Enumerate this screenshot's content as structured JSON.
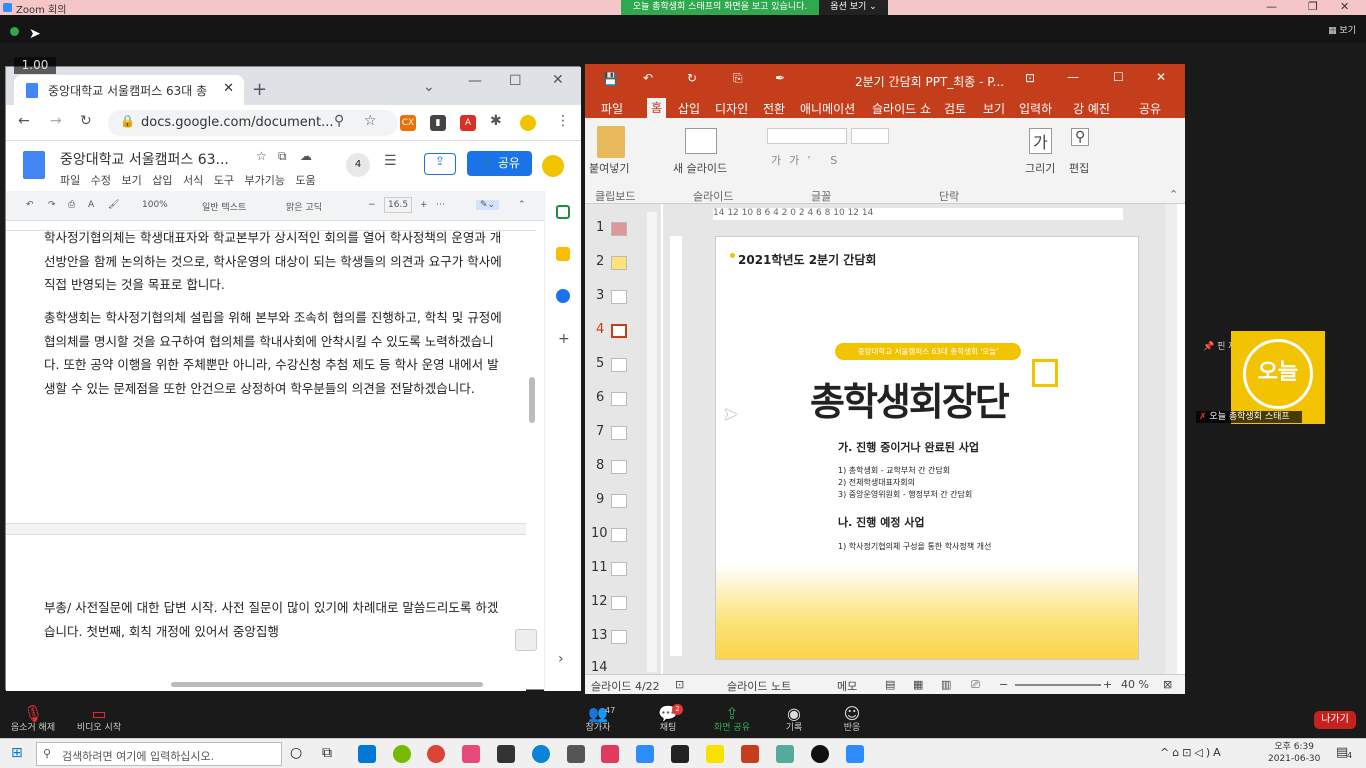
{
  "zoom": {
    "window_title": "Zoom 회의",
    "share_banner": "오늘 총학생회 스태프의 화면을 보고 있습니다.",
    "view_options": "옵션 보기 ⌄",
    "view_label": "▦ 보기",
    "zoom_level": "1.00",
    "pin_label": "📌 핀 제거",
    "participant_name": "오늘 총학생회 스태프",
    "participant_initials": "오늘\nz",
    "bottom": {
      "mute": "음소거 해제",
      "video": "비디오 시작",
      "participants": "참가자",
      "participants_count": "47",
      "chat": "채팅",
      "chat_badge": "2",
      "share": "화면 공유",
      "record": "기록",
      "reactions": "반응",
      "leave": "나가기"
    }
  },
  "chrome": {
    "tab_title": "중앙대학교 서울캠퍼스 63대 총",
    "url": "docs.google.com/document...",
    "doc_title": "중앙대학교 서울캠퍼스 63...",
    "menu": [
      "파일",
      "수정",
      "보기",
      "삽입",
      "서식",
      "도구",
      "부가기능",
      "도움"
    ],
    "share_label": "공유",
    "comment_count": "4",
    "toolbar": {
      "zoom": "100%",
      "style": "일반 텍스트",
      "font": "맑은 고딕",
      "size": "16.5"
    },
    "paragraphs": [
      "학사정기협의체는 학생대표자와 학교본부가 상시적인 회의를 열어 학사정책의 운영과 개선방안을 함께 논의하는 것으로, 학사운영의 대상이 되는 학생들의 의견과 요구가 학사에 직접 반영되는 것을 목표로 합니다.",
      "총학생회는 학사정기협의체 설립을 위해 본부와 조속히 협의를 진행하고, 학칙 및 규정에 협의체를 명시할 것을 요구하여 협의체를 학내사회에 안착시킬 수 있도록 노력하겠습니다. 또한 공약 이행을 위한 주체뿐만 아니라, 수강신청 추첨 제도 등 학사 운영 내에서 발생할 수 있는 문제점을 또한 안건으로 상정하여 학우분들의 의견을 전달하겠습니다.",
      "부총/ 사전질문에 대한 답변 시작. 사전 질문이 많이 있기에 차례대로 말씀드리도록 하겠습니다. 첫번째, 회칙 개정에 있어서 중앙집행"
    ]
  },
  "ppt": {
    "title": "2분기 간담회 PPT_최종 - P...",
    "user": "강 예진",
    "share": "공유",
    "tabs": [
      "파일",
      "홈",
      "삽입",
      "디자인",
      "전환",
      "애니메이션",
      "슬라이드 쇼",
      "검토",
      "보기",
      "입력하",
      "강 예진",
      "공유"
    ],
    "ribbon": {
      "paste": "붙여넣기",
      "new_slide": "새 슬라이드",
      "draw": "그리기",
      "edit": "편집",
      "g_clipboard": "클립보드",
      "g_slides": "슬라이드",
      "g_font": "글꼴",
      "g_para": "단락"
    },
    "ruler": "14 12 10 8 6 4 2 0 2 4 6 8 10 12 14",
    "thumbs": [
      "1",
      "2",
      "3",
      "4",
      "5",
      "6",
      "7",
      "8",
      "9",
      "10",
      "11",
      "12",
      "13",
      "14"
    ],
    "slide": {
      "header": "2021학년도 2분기 간담회",
      "pill": "중앙대학교 서울캠퍼스 63대 총학생회 '오늘'",
      "big_title": "총학생회장단",
      "sec1": "가. 진행 중이거나 완료된 사업",
      "items1": [
        "1) 총학생회 - 교학부처 간 간담회",
        "2) 전체학생대표자회의",
        "3) 중앙운영위원회 - 행정부처 간 간담회"
      ],
      "sec2": "나. 진행 예정 사업",
      "items2": [
        "1) 학사정기협의체 구성을 통한 학사정책 개선"
      ]
    },
    "status": {
      "slide": "슬라이드 4/22",
      "notes": "슬라이드 노트",
      "memo": "메모",
      "zoom": "40 %"
    }
  },
  "taskbar": {
    "search_placeholder": "검색하려면 여기에 입력하십시오.",
    "time": "오후 6:39",
    "date": "2021-06-30",
    "notif": "4"
  },
  "colors": {
    "ppt_red": "#c43e1c",
    "zoom_green": "#2fa84f",
    "docs_blue": "#4285f4",
    "leave_red": "#c5221f",
    "yellow": "#f2c300"
  }
}
